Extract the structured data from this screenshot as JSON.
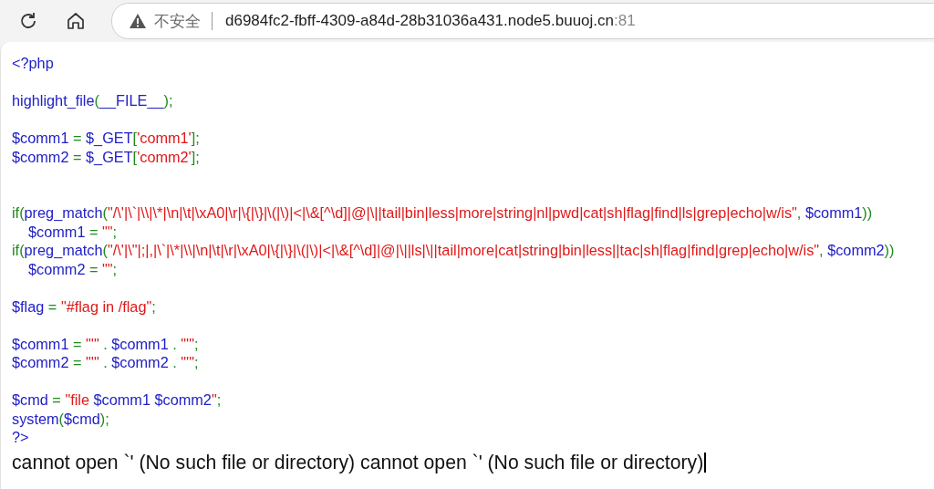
{
  "toolbar": {
    "address": {
      "warning": "不安全",
      "host": "d6984fc2-fbff-4309-a84d-28b31036a431.node5.buuoj.cn",
      "port": ":81"
    }
  },
  "code_lines": [
    {
      "kind": "code",
      "indent": false,
      "tokens": [
        {
          "kind": "default",
          "text": "<?php"
        }
      ]
    },
    {
      "kind": "blank"
    },
    {
      "kind": "code",
      "indent": false,
      "tokens": [
        {
          "kind": "default",
          "text": "highlight_file"
        },
        {
          "kind": "keyword",
          "text": "("
        },
        {
          "kind": "default",
          "text": "__FILE__"
        },
        {
          "kind": "keyword",
          "text": ");"
        }
      ]
    },
    {
      "kind": "blank"
    },
    {
      "kind": "code",
      "indent": false,
      "tokens": [
        {
          "kind": "default",
          "text": "$comm1 "
        },
        {
          "kind": "keyword",
          "text": "= "
        },
        {
          "kind": "default",
          "text": "$_GET"
        },
        {
          "kind": "keyword",
          "text": "["
        },
        {
          "kind": "string",
          "text": "'comm1'"
        },
        {
          "kind": "keyword",
          "text": "];"
        }
      ]
    },
    {
      "kind": "code",
      "indent": false,
      "tokens": [
        {
          "kind": "default",
          "text": "$comm2 "
        },
        {
          "kind": "keyword",
          "text": "= "
        },
        {
          "kind": "default",
          "text": "$_GET"
        },
        {
          "kind": "keyword",
          "text": "["
        },
        {
          "kind": "string",
          "text": "'comm2'"
        },
        {
          "kind": "keyword",
          "text": "];"
        }
      ]
    },
    {
      "kind": "blank"
    },
    {
      "kind": "blank"
    },
    {
      "kind": "code",
      "indent": false,
      "tokens": [
        {
          "kind": "keyword",
          "text": "if("
        },
        {
          "kind": "default",
          "text": "preg_match"
        },
        {
          "kind": "keyword",
          "text": "("
        },
        {
          "kind": "string",
          "text": "\"/\\'|\\`|\\\\|\\*|\\n|\\t|\\xA0|\\r|\\{|\\}|\\(|\\)|<|\\&[^\\d]|@|\\||tail|bin|less|more|string|nl|pwd|cat|sh|flag|find|ls|grep|echo|w/is\""
        },
        {
          "kind": "keyword",
          "text": ", "
        },
        {
          "kind": "default",
          "text": "$comm1"
        },
        {
          "kind": "keyword",
          "text": "))"
        }
      ]
    },
    {
      "kind": "code",
      "indent": true,
      "tokens": [
        {
          "kind": "default",
          "text": "$comm1 "
        },
        {
          "kind": "keyword",
          "text": "= "
        },
        {
          "kind": "string",
          "text": "\"\""
        },
        {
          "kind": "keyword",
          "text": ";"
        }
      ]
    },
    {
      "kind": "code",
      "indent": false,
      "tokens": [
        {
          "kind": "keyword",
          "text": "if("
        },
        {
          "kind": "default",
          "text": "preg_match"
        },
        {
          "kind": "keyword",
          "text": "("
        },
        {
          "kind": "string",
          "text": "\"/\\'|\\\"|;|,|\\`|\\*|\\\\|\\n|\\t|\\r|\\xA0|\\{|\\}|\\(|\\)|<|\\&[^\\d]|@|\\||ls|\\||tail|more|cat|string|bin|less||tac|sh|flag|find|grep|echo|w/is\""
        },
        {
          "kind": "keyword",
          "text": ", "
        },
        {
          "kind": "default",
          "text": "$comm2"
        },
        {
          "kind": "keyword",
          "text": "))"
        }
      ]
    },
    {
      "kind": "code",
      "indent": true,
      "tokens": [
        {
          "kind": "default",
          "text": "$comm2 "
        },
        {
          "kind": "keyword",
          "text": "= "
        },
        {
          "kind": "string",
          "text": "\"\""
        },
        {
          "kind": "keyword",
          "text": ";"
        }
      ]
    },
    {
      "kind": "blank"
    },
    {
      "kind": "code",
      "indent": false,
      "tokens": [
        {
          "kind": "default",
          "text": "$flag "
        },
        {
          "kind": "keyword",
          "text": "= "
        },
        {
          "kind": "string",
          "text": "\"#flag in /flag\""
        },
        {
          "kind": "keyword",
          "text": ";"
        }
      ]
    },
    {
      "kind": "blank"
    },
    {
      "kind": "code",
      "indent": false,
      "tokens": [
        {
          "kind": "default",
          "text": "$comm1 "
        },
        {
          "kind": "keyword",
          "text": "= "
        },
        {
          "kind": "string",
          "text": "\"'\" "
        },
        {
          "kind": "keyword",
          "text": ". "
        },
        {
          "kind": "default",
          "text": "$comm1 "
        },
        {
          "kind": "keyword",
          "text": ". "
        },
        {
          "kind": "string",
          "text": "\"'\""
        },
        {
          "kind": "keyword",
          "text": ";"
        }
      ]
    },
    {
      "kind": "code",
      "indent": false,
      "tokens": [
        {
          "kind": "default",
          "text": "$comm2 "
        },
        {
          "kind": "keyword",
          "text": "= "
        },
        {
          "kind": "string",
          "text": "\"'\" "
        },
        {
          "kind": "keyword",
          "text": ". "
        },
        {
          "kind": "default",
          "text": "$comm2 "
        },
        {
          "kind": "keyword",
          "text": ". "
        },
        {
          "kind": "string",
          "text": "\"'\""
        },
        {
          "kind": "keyword",
          "text": ";"
        }
      ]
    },
    {
      "kind": "blank"
    },
    {
      "kind": "code",
      "indent": false,
      "tokens": [
        {
          "kind": "default",
          "text": "$cmd "
        },
        {
          "kind": "keyword",
          "text": "= "
        },
        {
          "kind": "string",
          "text": "\"file "
        },
        {
          "kind": "default",
          "text": "$comm1 $comm2"
        },
        {
          "kind": "string",
          "text": "\""
        },
        {
          "kind": "keyword",
          "text": ";"
        }
      ]
    },
    {
      "kind": "code",
      "indent": false,
      "tokens": [
        {
          "kind": "default",
          "text": "system"
        },
        {
          "kind": "keyword",
          "text": "("
        },
        {
          "kind": "default",
          "text": "$cmd"
        },
        {
          "kind": "keyword",
          "text": ");"
        }
      ]
    },
    {
      "kind": "code",
      "indent": false,
      "tokens": [
        {
          "kind": "default",
          "text": "?>"
        }
      ]
    }
  ],
  "output": "cannot open `' (No such file or directory) cannot open `' (No such file or directory)"
}
